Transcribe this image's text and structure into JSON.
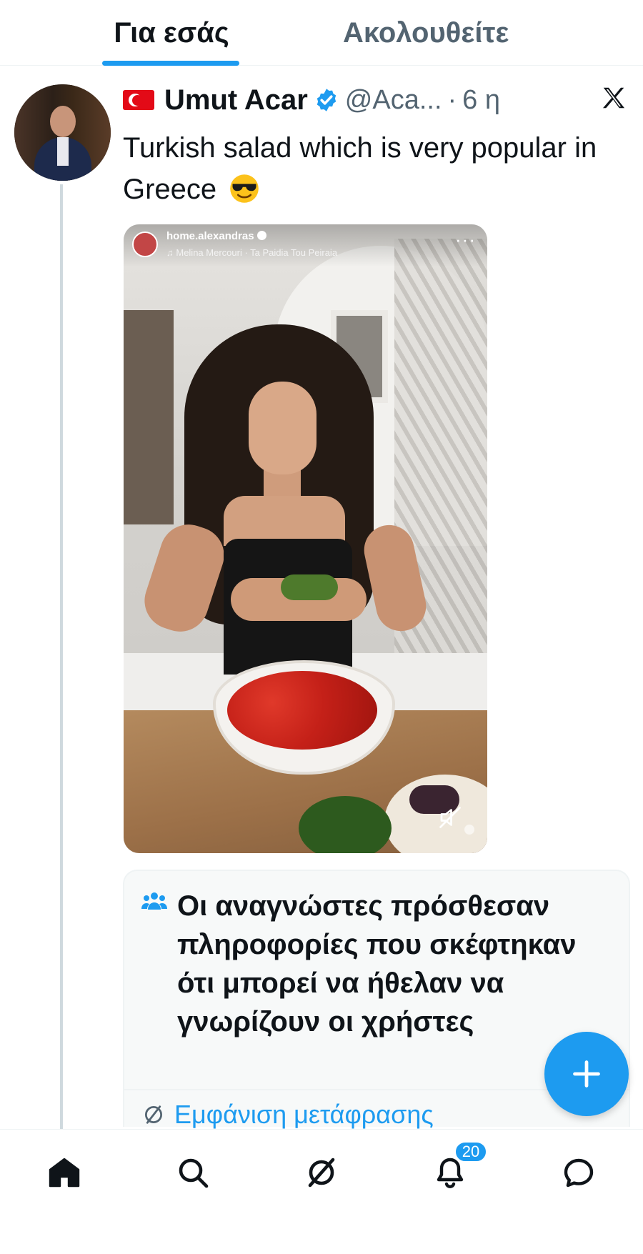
{
  "tabs": [
    {
      "label": "Για εσάς",
      "active": true
    },
    {
      "label": "Ακολουθείτε",
      "active": false
    }
  ],
  "post": {
    "author_name": "Umut Acar",
    "author_flag": "turkey-flag-icon",
    "verified": true,
    "handle": "@Aca...",
    "separator": "·",
    "time": "6 η",
    "text": "Turkish salad which is very popular in Greece",
    "emoji": "smiling-face-with-sunglasses",
    "video": {
      "account": "home.alexandras",
      "song": "♫ Melina Mercouri · Ta Paidia Tou Peiraia",
      "menu": "···",
      "muted": true
    }
  },
  "community_note": {
    "title": "Οι αναγνώστες πρόσθεσαν πληροφορίες που σκέφτηκαν ότι μπορεί να ήθελαν να γνωρίζουν οι χρήστες",
    "translate_label": "Εμφάνιση μετάφρασης"
  },
  "fab": {
    "label": "+"
  },
  "bottom_nav": {
    "items": [
      "home-icon",
      "search-icon",
      "grok-icon",
      "notifications-icon",
      "messages-icon"
    ],
    "notifications_count": "20"
  },
  "colors": {
    "accent": "#1d9bf0",
    "text_primary": "#0f1419",
    "text_secondary": "#536471"
  }
}
